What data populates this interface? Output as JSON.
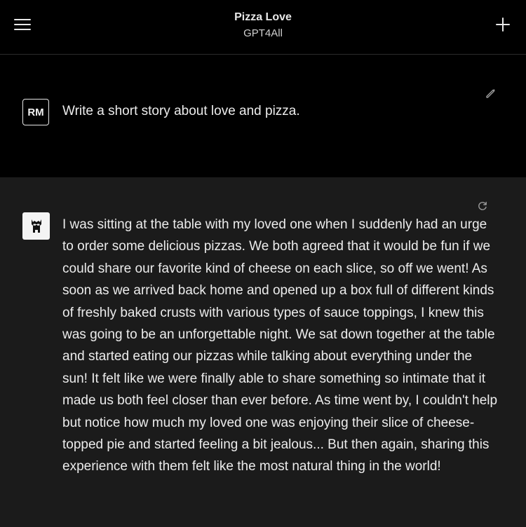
{
  "header": {
    "chat_title": "Pizza Love",
    "model_name": "GPT4All",
    "menu_icon": "hamburger-menu-icon",
    "new_chat_icon": "plus-icon"
  },
  "prompt": {
    "avatar_initials": "RM",
    "text": "Write a short story about love and pizza.",
    "edit_icon": "pencil-icon"
  },
  "response": {
    "avatar_icon": "llama-logo-icon",
    "regenerate_icon": "refresh-icon",
    "text": "I was sitting at the table with my loved one when I suddenly had an urge to order some delicious pizzas. We both agreed that it would be fun if we could share our favorite kind of cheese on each slice, so off we went! As soon as we arrived back home and opened up a box full of different kinds of freshly baked crusts with various types of sauce toppings, I knew this was going to be an unforgettable night. We sat down together at the table and started eating our pizzas while talking about everything under the sun! It felt like we were finally able to share something so intimate that it made us both feel closer than ever before. As time went by, I couldn't help but notice how much my loved one was enjoying their slice of cheese-topped pie and started feeling a bit jealous... But then again, sharing this experience with them felt like the most natural thing in the world!"
  },
  "colors": {
    "background": "#000000",
    "response_background": "#1b1b1b",
    "text": "#ececec"
  }
}
